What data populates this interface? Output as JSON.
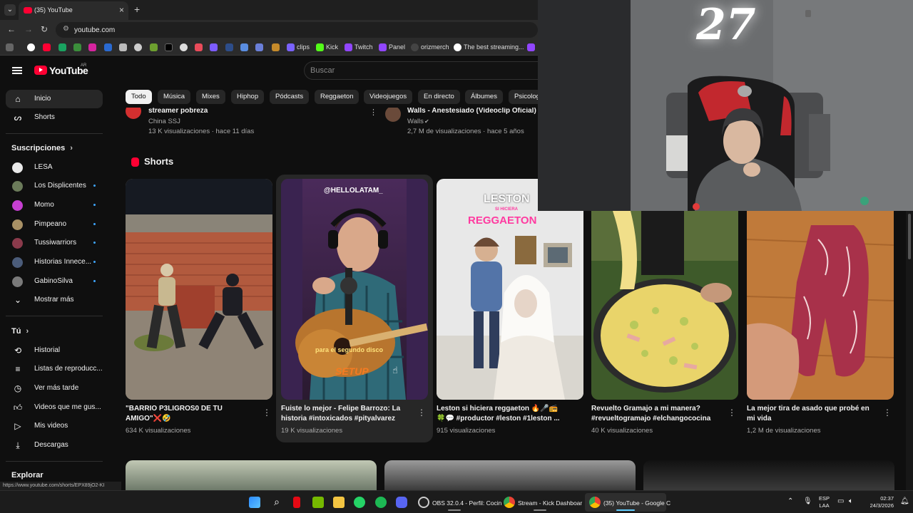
{
  "browser": {
    "tab_title": "(35) YouTube",
    "url": "youtube.com",
    "bookmarks": [
      "clips",
      "Kick",
      "Twitch",
      "Panel",
      "orizmerch",
      "The best streaming..."
    ]
  },
  "youtube": {
    "logo_text": "YouTube",
    "region": "AR",
    "search_placeholder": "Buscar"
  },
  "sidebar": {
    "main": [
      {
        "label": "Inicio"
      },
      {
        "label": "Shorts"
      }
    ],
    "subscriptions_heading": "Suscripciones",
    "subscriptions": [
      {
        "label": "LESA",
        "color": "#e9e9e9"
      },
      {
        "label": "Los Displicentes",
        "color": "#6b7b5a"
      },
      {
        "label": "Momo",
        "color": "#c63fd1"
      },
      {
        "label": "Pimpeano",
        "color": "#a89065"
      },
      {
        "label": "Tussiwarriors",
        "color": "#8a3a4b"
      },
      {
        "label": "Historias Innece...",
        "color": "#4b5c7a"
      },
      {
        "label": "GabinoSilva",
        "color": "#7a7a7a"
      }
    ],
    "show_more": "Mostrar más",
    "you_heading": "Tú",
    "you_items": [
      {
        "label": "Historial"
      },
      {
        "label": "Listas de reproducc..."
      },
      {
        "label": "Ver más tarde"
      },
      {
        "label": "Videos que me gus..."
      },
      {
        "label": "Mis videos"
      },
      {
        "label": "Descargas"
      }
    ],
    "explore_heading": "Explorar"
  },
  "chips": [
    "Todo",
    "Música",
    "Mixes",
    "Hiphop",
    "Pódcasts",
    "Reggaeton",
    "Videojuegos",
    "En directo",
    "Álbumes",
    "Psicolog"
  ],
  "previous_row": [
    {
      "title": "streamer pobreza",
      "channel": "China SSJ",
      "meta": "13 K visualizaciones · hace 11 días"
    },
    {
      "title": "Walls - Anestesiado (Videoclip Oficial)",
      "channel": "Walls",
      "meta": "2,7 M de visualizaciones · hace 5 años"
    }
  ],
  "shorts_heading": "Shorts",
  "shorts": [
    {
      "title_line1": "\"BARRIO P3LIGROS0 DE TU",
      "title_line2": "AMIGO\"❌🤣",
      "views": "634 K visualizaciones"
    },
    {
      "title_line1": "Fuiste lo mejor - Felipe Barrozo: La",
      "title_line2": "historia #intoxicados #pityalvarez",
      "views": "19 K visualizaciones",
      "overlay_top": "@HELLOLATAM_",
      "overlay_caption": "para el segundo disco",
      "overlay_logo": "SETUP"
    },
    {
      "title_line1": "Leston si hiciera reggaeton 🔥🎤📻",
      "title_line2": "🍀💬 #productor #leston #1leston ...",
      "views": "915 visualizaciones",
      "overlay_top": "LESTON",
      "overlay_sub": "SI HICIERA",
      "overlay_main": "REGGAETON"
    },
    {
      "title_line1": "Revuelto Gramajo a mi manera?",
      "title_line2": "#revueltogramajo #elchangococina",
      "views": "40 K visualizaciones"
    },
    {
      "title_line1": "La mejor tira de asado que probé en",
      "title_line2": "mi vida",
      "views": "1,2 M de visualizaciones"
    }
  ],
  "status_link": "https://www.youtube.com/shorts/EPX89jO2-KI",
  "webcam": {
    "sign": "27"
  },
  "taskbar": {
    "apps": [
      {
        "label": "OBS 32.0.4 - Perfil: Cocin"
      },
      {
        "label": "Stream - Kick Dashboar"
      },
      {
        "label": "(35) YouTube - Google C"
      }
    ],
    "lang_line1": "ESP",
    "lang_line2": "LAA",
    "time": "02:37",
    "date": "24/3/2026"
  }
}
